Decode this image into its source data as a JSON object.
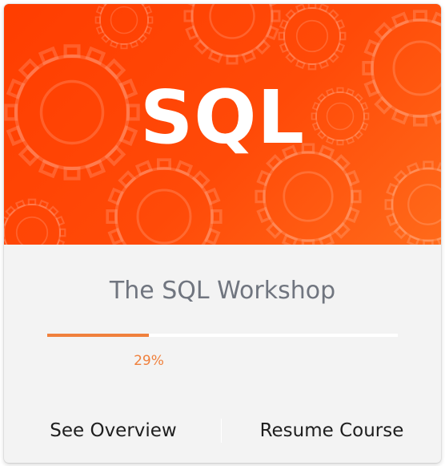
{
  "banner": {
    "title": "SQL",
    "background_color": "#ff4a08",
    "pattern_icon": "gear-icon"
  },
  "course": {
    "title": "The SQL Workshop"
  },
  "progress": {
    "percent": 29,
    "label": "29%",
    "color": "#f0803c"
  },
  "actions": {
    "overview_label": "See Overview",
    "resume_label": "Resume Course"
  }
}
